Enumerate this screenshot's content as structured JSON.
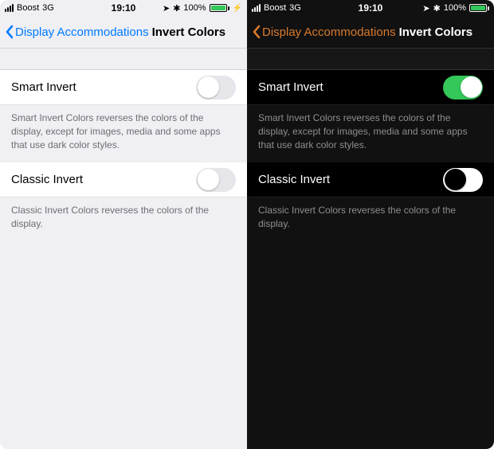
{
  "status": {
    "carrier": "Boost",
    "network": "3G",
    "time": "19:10",
    "battery_pct": "100%"
  },
  "nav": {
    "back_label": "Display Accommodations",
    "title": "Invert Colors"
  },
  "smart_invert": {
    "label": "Smart Invert",
    "desc": "Smart Invert Colors reverses the colors of the display, except for images, media and some apps that use dark color styles."
  },
  "classic_invert": {
    "label": "Classic Invert",
    "desc": "Classic Invert Colors reverses the colors of the display."
  }
}
